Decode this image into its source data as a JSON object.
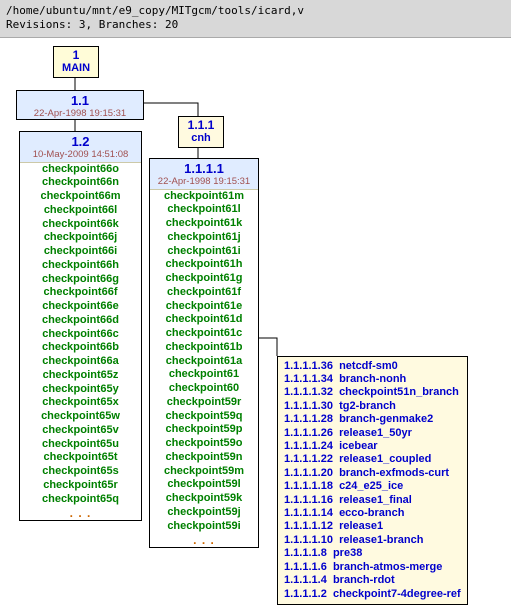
{
  "header": {
    "path": "/home/ubuntu/mnt/e9_copy/MITgcm/tools/icard,v",
    "stats": "Revisions: 3, Branches: 20"
  },
  "main_node": {
    "num": "1",
    "label": "MAIN"
  },
  "rev_1_1": {
    "rev": "1.1",
    "date": "22-Apr-1998 19:15:31"
  },
  "rev_1_2": {
    "rev": "1.2",
    "date": "10-May-2009 14:51:08",
    "tags": [
      "checkpoint66o",
      "checkpoint66n",
      "checkpoint66m",
      "checkpoint66l",
      "checkpoint66k",
      "checkpoint66j",
      "checkpoint66i",
      "checkpoint66h",
      "checkpoint66g",
      "checkpoint66f",
      "checkpoint66e",
      "checkpoint66d",
      "checkpoint66c",
      "checkpoint66b",
      "checkpoint66a",
      "checkpoint65z",
      "checkpoint65y",
      "checkpoint65x",
      "checkpoint65w",
      "checkpoint65v",
      "checkpoint65u",
      "checkpoint65t",
      "checkpoint65s",
      "checkpoint65r",
      "checkpoint65q"
    ],
    "more": ". . ."
  },
  "branch_1_1_1": {
    "num": "1.1.1",
    "label": "cnh"
  },
  "rev_1_1_1_1": {
    "rev": "1.1.1.1",
    "date": "22-Apr-1998 19:15:31",
    "tags": [
      "checkpoint61m",
      "checkpoint61l",
      "checkpoint61k",
      "checkpoint61j",
      "checkpoint61i",
      "checkpoint61h",
      "checkpoint61g",
      "checkpoint61f",
      "checkpoint61e",
      "checkpoint61d",
      "checkpoint61c",
      "checkpoint61b",
      "checkpoint61a",
      "checkpoint61",
      "checkpoint60",
      "checkpoint59r",
      "checkpoint59q",
      "checkpoint59p",
      "checkpoint59o",
      "checkpoint59n",
      "checkpoint59m",
      "checkpoint59l",
      "checkpoint59k",
      "checkpoint59j",
      "checkpoint59i"
    ],
    "more": ". . ."
  },
  "branches_out": [
    {
      "num": "1.1.1.1.36",
      "label": "netcdf-sm0"
    },
    {
      "num": "1.1.1.1.34",
      "label": "branch-nonh"
    },
    {
      "num": "1.1.1.1.32",
      "label": "checkpoint51n_branch"
    },
    {
      "num": "1.1.1.1.30",
      "label": "tg2-branch"
    },
    {
      "num": "1.1.1.1.28",
      "label": "branch-genmake2"
    },
    {
      "num": "1.1.1.1.26",
      "label": "release1_50yr"
    },
    {
      "num": "1.1.1.1.24",
      "label": "icebear"
    },
    {
      "num": "1.1.1.1.22",
      "label": "release1_coupled"
    },
    {
      "num": "1.1.1.1.20",
      "label": "branch-exfmods-curt"
    },
    {
      "num": "1.1.1.1.18",
      "label": "c24_e25_ice"
    },
    {
      "num": "1.1.1.1.16",
      "label": "release1_final"
    },
    {
      "num": "1.1.1.1.14",
      "label": "ecco-branch"
    },
    {
      "num": "1.1.1.1.12",
      "label": "release1"
    },
    {
      "num": "1.1.1.1.10",
      "label": "release1-branch"
    },
    {
      "num": "1.1.1.1.8",
      "label": "pre38"
    },
    {
      "num": "1.1.1.1.6",
      "label": "branch-atmos-merge"
    },
    {
      "num": "1.1.1.1.4",
      "label": "branch-rdot"
    },
    {
      "num": "1.1.1.1.2",
      "label": "checkpoint7-4degree-ref"
    }
  ],
  "chart_data": {
    "type": "table",
    "title": "CVS revision graph for icard,v",
    "revisions": 3,
    "branches": 20,
    "nodes": [
      {
        "id": "1",
        "label": "MAIN",
        "kind": "trunk"
      },
      {
        "id": "1.1",
        "date": "22-Apr-1998 19:15:31",
        "kind": "revision"
      },
      {
        "id": "1.2",
        "date": "10-May-2009 14:51:08",
        "kind": "revision"
      },
      {
        "id": "1.1.1",
        "label": "cnh",
        "kind": "branch"
      },
      {
        "id": "1.1.1.1",
        "date": "22-Apr-1998 19:15:31",
        "kind": "revision"
      }
    ],
    "edges": [
      {
        "from": "1",
        "to": "1.1"
      },
      {
        "from": "1.1",
        "to": "1.2"
      },
      {
        "from": "1.1",
        "to": "1.1.1"
      },
      {
        "from": "1.1.1",
        "to": "1.1.1.1"
      },
      {
        "from": "1.1.1.1",
        "to": "branches_out"
      }
    ]
  }
}
